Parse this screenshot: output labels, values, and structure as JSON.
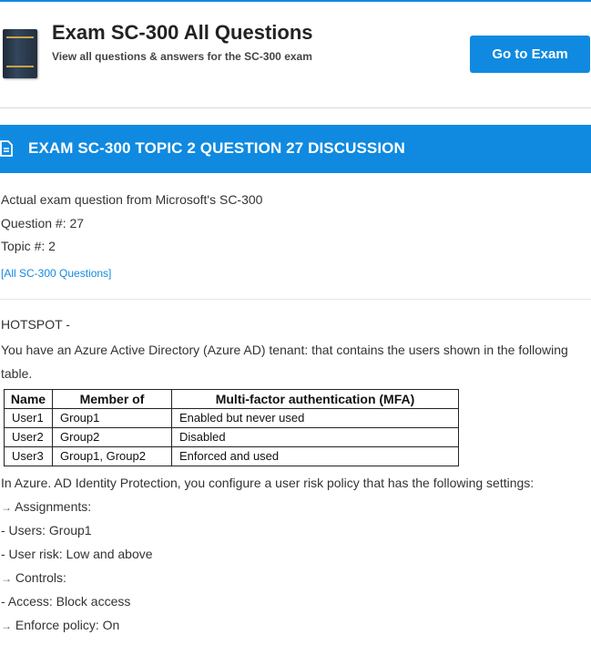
{
  "header": {
    "title": "Exam SC-300 All Questions",
    "subtitle": "View all questions & answers for the SC-300 exam",
    "cta_label": "Go to Exam",
    "accent_color": "#0f8ae0"
  },
  "banner": {
    "icon": "document-icon",
    "title": "EXAM SC-300 TOPIC 2 QUESTION 27 DISCUSSION"
  },
  "meta": {
    "source": "Actual exam question from Microsoft's SC-300",
    "question_number": "Question #: 27",
    "topic_number": "Topic #: 2",
    "all_questions_link": "[All SC-300 Questions]"
  },
  "question": {
    "type_label": "HOTSPOT -",
    "intro": "You have an Azure Active Directory (Azure AD) tenant: that contains the users shown in the following table.",
    "table": {
      "headers": [
        "Name",
        "Member of",
        "Multi-factor authentication (MFA)"
      ],
      "rows": [
        [
          "User1",
          "Group1",
          "Enabled but never used"
        ],
        [
          "User2",
          "Group2",
          "Disabled"
        ],
        [
          "User3",
          "Group1, Group2",
          "Enforced and used"
        ]
      ]
    },
    "policy_intro": "In Azure. AD Identity Protection, you configure a user risk policy that has the following settings:",
    "bullet_glyph": "→",
    "assignments_label": "Assignments:",
    "users_setting": "- Users: Group1",
    "risk_setting": "- User risk: Low and above",
    "controls_label": "Controls:",
    "access_setting": "- Access: Block access",
    "enforce_label": "Enforce policy: On"
  }
}
